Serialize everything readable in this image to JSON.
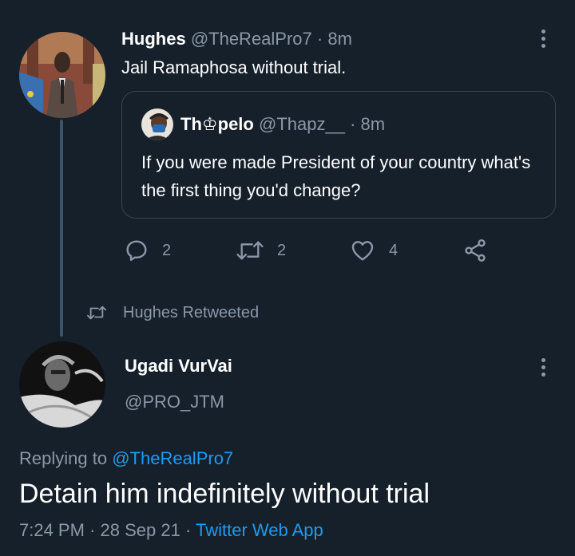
{
  "tweet": {
    "author_name": "Hughes",
    "author_handle": "@TheRealPro7",
    "separator": "·",
    "time": "8m",
    "text": "Jail Ramaphosa without trial."
  },
  "quoted": {
    "name_part1": "Th",
    "name_glyph": "♔",
    "name_part2": "pelo",
    "handle": "@Thapz__",
    "separator": "·",
    "time": "8m",
    "text": "If you were made President of your country what's the first thing you'd change?"
  },
  "actions": {
    "reply_count": "2",
    "retweet_count": "2",
    "like_count": "4"
  },
  "retweet_context": {
    "label": "Hughes Retweeted"
  },
  "detail": {
    "author_name": "Ugadi VurVai",
    "author_handle": "@PRO_JTM",
    "replying_prefix": "Replying to",
    "replying_handle": "@TheRealPro7",
    "text": "Detain him indefinitely without trial",
    "time": "7:24 PM",
    "sep1": "·",
    "date": "28 Sep 21",
    "sep2": "·",
    "source": "Twitter Web App"
  },
  "colors": {
    "background": "#15202b",
    "muted": "#8b98a5",
    "link": "#1d9bf0",
    "border": "#38444d"
  },
  "icons": {
    "reply": "reply-icon",
    "retweet": "retweet-icon",
    "like": "heart-icon",
    "share": "share-icon",
    "more": "more-dots-icon"
  }
}
